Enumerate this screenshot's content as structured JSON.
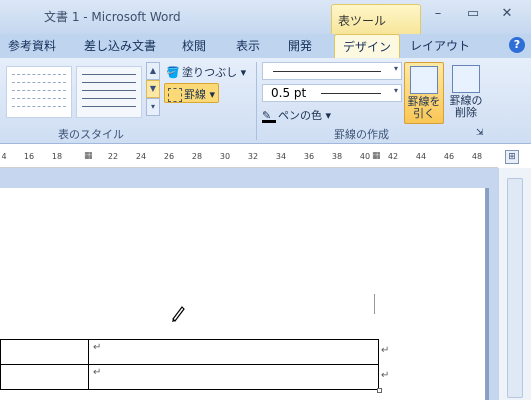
{
  "window": {
    "title": "文書 1 - Microsoft Word",
    "tool_tab_header": "表ツール"
  },
  "tabs": [
    "参考資料",
    "差し込み文書",
    "校閲",
    "表示",
    "開発",
    "デザイン",
    "レイアウト"
  ],
  "active_tab": "デザイン",
  "groups": {
    "table_styles": {
      "label": "表のスタイル",
      "shading": "塗りつぶし",
      "borders": "罫線"
    },
    "draw_borders": {
      "label": "罫線の作成",
      "line_weight": "0.5 pt",
      "pen_color": "ペンの色",
      "draw_table": "罫線を\n引く",
      "eraser": "罫線の\n削除"
    }
  },
  "ruler_ticks": [
    "4",
    "16",
    "18",
    "22",
    "24",
    "26",
    "28",
    "30",
    "32",
    "34",
    "36",
    "38",
    "40",
    "42",
    "44",
    "46",
    "48"
  ],
  "table": {
    "rows": [
      [
        "",
        "↵",
        "↵"
      ],
      [
        "",
        "↵",
        "↵"
      ]
    ]
  },
  "colors": {
    "accent": "#fbd976",
    "ribbon": "#dbe7f6"
  }
}
